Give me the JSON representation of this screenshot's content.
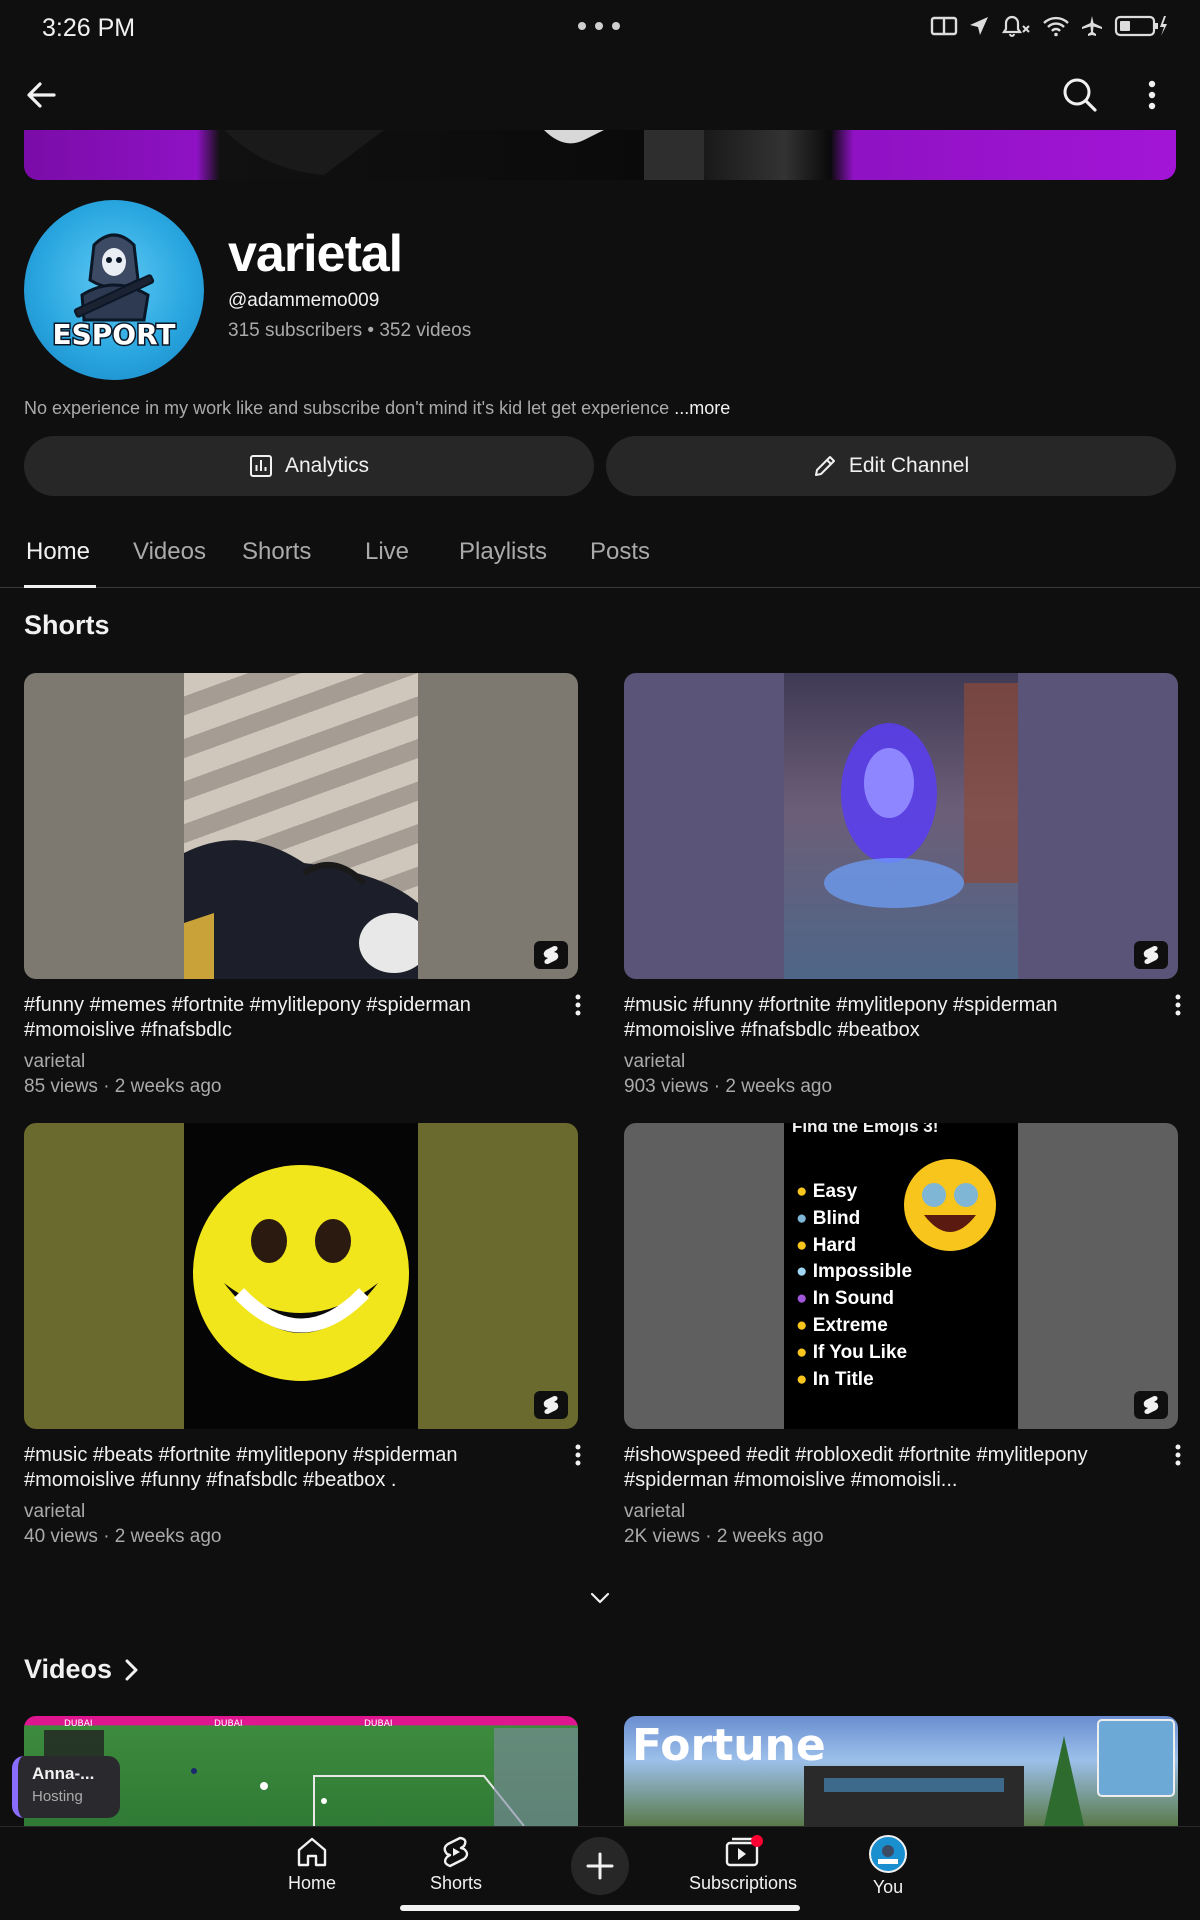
{
  "status_bar": {
    "time": "3:26 PM"
  },
  "channel": {
    "name": "varietal",
    "handle": "@adammemo009",
    "stats": "315 subscribers • 352 videos",
    "description": "No experience in my work like and subscribe don't mind it's kid let get experience ",
    "more_label": "...more",
    "avatar_text": "ESPORT"
  },
  "actions": {
    "analytics_label": "Analytics",
    "edit_label": "Edit Channel"
  },
  "tabs": [
    "Home",
    "Videos",
    "Shorts",
    "Live",
    "Playlists",
    "Posts"
  ],
  "sections": {
    "shorts_title": "Shorts",
    "videos_title": "Videos"
  },
  "shorts": [
    {
      "title": "#funny #memes #fortnite #mylitlepony #spiderman #momoislive #fnafsbdlc",
      "channel": "varietal",
      "meta": "85 views · 2 weeks ago"
    },
    {
      "title": "#music #funny #fortnite #mylitlepony #spiderman #momoislive #fnafsbdlc #beatbox",
      "channel": "varietal",
      "meta": "903 views · 2 weeks ago"
    },
    {
      "title": "#music #beats #fortnite #mylitlepony #spiderman #momoislive #funny #fnafsbdlc #beatbox .",
      "channel": "varietal",
      "meta": "40 views · 2 weeks ago"
    },
    {
      "title": "#ishowspeed #edit #robloxedit #fortnite #mylitlepony #spiderman #momoislive #momoisli...",
      "channel": "varietal",
      "meta": "2K views · 2 weeks ago"
    }
  ],
  "emoji_list": [
    "Easy",
    "Blind",
    "Hard",
    "Impossible",
    "In Sound",
    "Extreme",
    "If You Like",
    "In Title"
  ],
  "emoji_heading": "Find the Emojis 3!",
  "videos": [
    {
      "thumb_text": "DUBAI"
    },
    {
      "thumb_text": "Fortune"
    }
  ],
  "live_pill": {
    "name": "Anna-...",
    "status": "Hosting"
  },
  "bottom_nav": {
    "home": "Home",
    "shorts": "Shorts",
    "subscriptions": "Subscriptions",
    "you": "You"
  }
}
